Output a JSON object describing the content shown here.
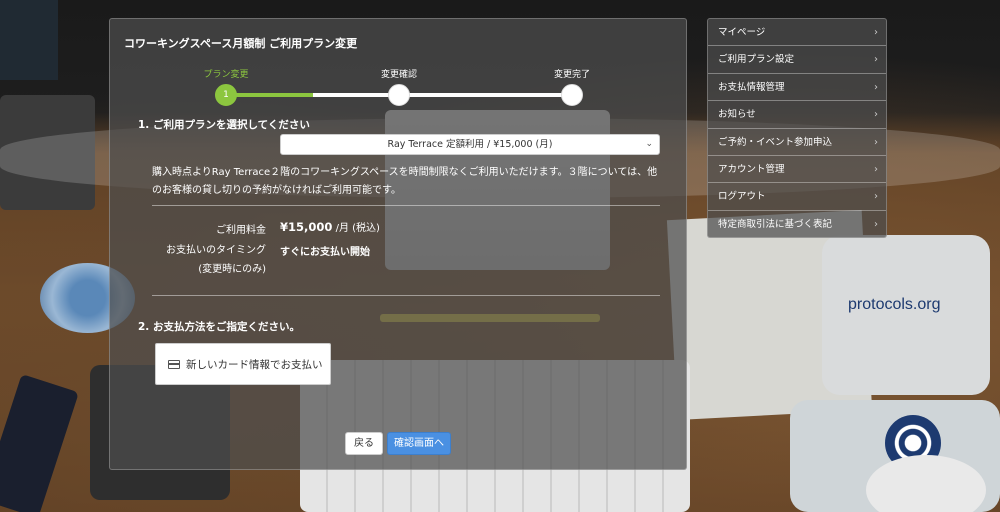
{
  "panel": {
    "title": "コワーキングスペース月額制 ご利用プラン変更"
  },
  "steps": [
    {
      "label": "プラン変更",
      "number": "1",
      "active": true
    },
    {
      "label": "変更確認",
      "number": "2",
      "active": false
    },
    {
      "label": "変更完了",
      "number": "3",
      "active": false
    }
  ],
  "section1": {
    "heading": "1. ご利用プランを選択してください",
    "selected_plan": "Ray Terrace 定額利用 / ¥15,000 (月)",
    "description": "購入時点よりRay Terrace２階のコワーキングスペースを時間制限なくご利用いただけます。３階については、他のお客様の貸し切りの予約がなければご利用可能です。",
    "fee_label": "ご利用料金",
    "fee_amount": "¥15,000",
    "fee_unit": "/月 (税込)",
    "timing_label_line1": "お支払いのタイミング",
    "timing_label_line2": "(変更時にのみ)",
    "timing_value": "すぐにお支払い開始"
  },
  "section2": {
    "heading": "2. お支払方法をご指定ください。",
    "card_button": "新しいカード情報でお支払い"
  },
  "actions": {
    "back": "戻る",
    "confirm": "確認画面へ"
  },
  "sidemenu": {
    "items": [
      "マイページ",
      "ご利用プラン設定",
      "お支払情報管理",
      "お知らせ",
      "ご予約・イベント参加申込",
      "アカウント管理",
      "ログアウト",
      "特定商取引法に基づく表記"
    ]
  },
  "background_text": {
    "logo": "protocols.org"
  },
  "colors": {
    "step_active": "#8cc63f",
    "primary_button": "#4a90e2"
  }
}
